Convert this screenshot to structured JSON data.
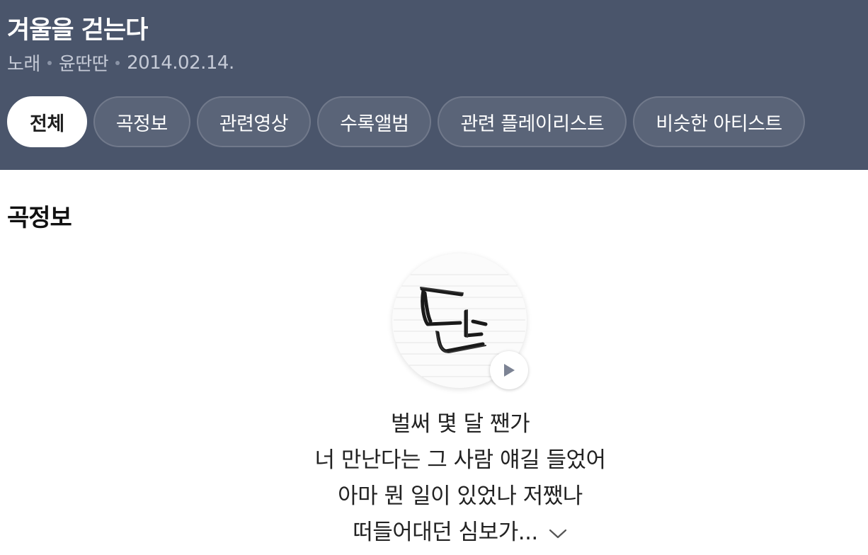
{
  "song": {
    "title": "겨울을 걷는다",
    "type": "노래",
    "artist": "윤딴딴",
    "date": "2014.02.14."
  },
  "tabs": [
    {
      "label": "전체",
      "active": true
    },
    {
      "label": "곡정보",
      "active": false
    },
    {
      "label": "관련영상",
      "active": false
    },
    {
      "label": "수록앨범",
      "active": false
    },
    {
      "label": "관련 플레이리스트",
      "active": false
    },
    {
      "label": "비슷한 아티스트",
      "active": false
    }
  ],
  "section": {
    "title": "곡정보"
  },
  "lyrics": {
    "lines": [
      "벌써 몇 달 짼가",
      "너 만난다는 그 사람 얘길 들었어",
      "아마 뭔 일이 있었나 저쨌나",
      "떠들어대던 심보가..."
    ]
  },
  "icons": {
    "play": "play-icon",
    "expand": "chevron-down-icon"
  },
  "colors": {
    "header_bg": "#4a556b",
    "active_tab_bg": "#ffffff"
  }
}
